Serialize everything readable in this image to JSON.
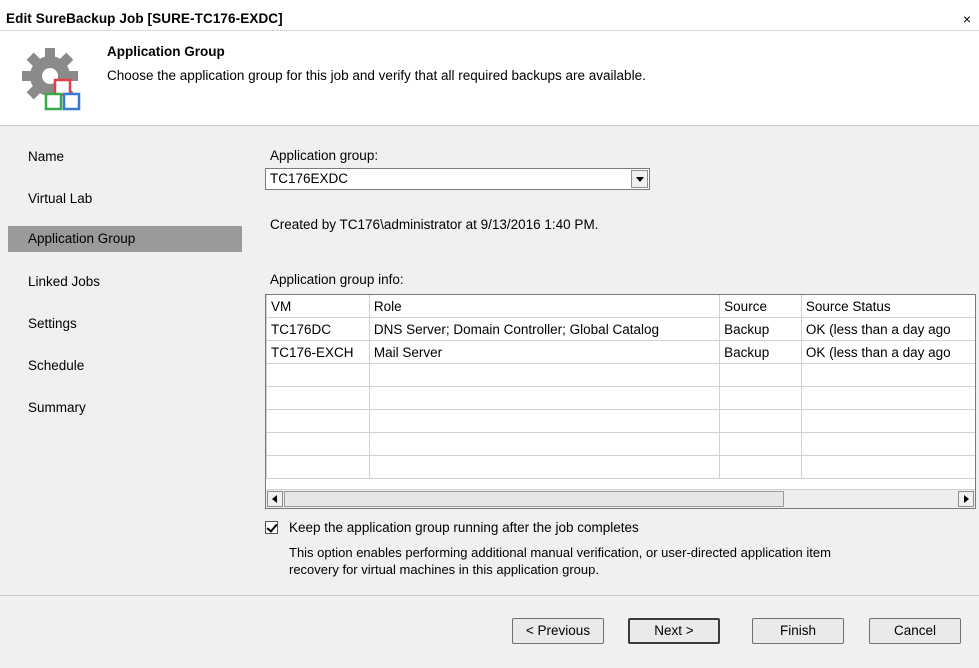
{
  "window": {
    "title": "Edit SureBackup Job [SURE-TC176-EXDC]",
    "close_glyph": "×"
  },
  "header": {
    "title": "Application Group",
    "description": "Choose the application group for this job and verify that all required backups are available.",
    "icon": "gear-icon"
  },
  "nav": {
    "items": [
      {
        "label": "Name"
      },
      {
        "label": "Virtual Lab"
      },
      {
        "label": "Application Group",
        "selected": true
      },
      {
        "label": "Linked Jobs"
      },
      {
        "label": "Settings"
      },
      {
        "label": "Schedule"
      },
      {
        "label": "Summary"
      }
    ]
  },
  "main": {
    "group_label": "Application group:",
    "group_value": "TC176EXDC",
    "created_text": "Created by TC176\\administrator at 9/13/2016 1:40 PM.",
    "info_label": "Application group info:",
    "table": {
      "columns": [
        "VM",
        "Role",
        "Source",
        "Source Status"
      ],
      "rows": [
        [
          "TC176DC",
          "DNS Server; Domain Controller; Global Catalog",
          "Backup",
          "OK (less than a day ago"
        ],
        [
          "TC176-EXCH",
          "Mail Server",
          "Backup",
          "OK (less than a day ago"
        ]
      ]
    },
    "keep_running_label": "Keep the application group running after the job completes",
    "keep_running_checked": true,
    "keep_running_desc_1": "This option enables performing additional manual verification, or user-directed application item",
    "keep_running_desc_2": "recovery for virtual machines in this application group."
  },
  "footer": {
    "previous": "< Previous",
    "next": "Next >",
    "finish": "Finish",
    "cancel": "Cancel"
  },
  "colors": {
    "selected_nav": "#9a9a9a",
    "panel_bg": "#f0f0f0"
  }
}
